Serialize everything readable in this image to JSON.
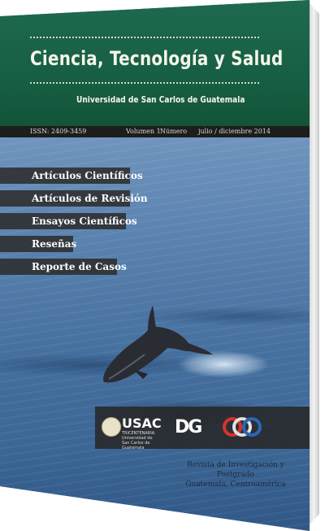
{
  "journal": {
    "title": "Ciencia, Tecnología y Salud",
    "institution": "Universidad de San Carlos de Guatemala"
  },
  "infobar": {
    "issn": "ISSN: 2409-3459",
    "volume": "Volumen 1",
    "number": "Número",
    "period": "julio / diciembre 2014"
  },
  "sections": [
    {
      "label": "Artículos Científicos"
    },
    {
      "label": "Artículos de Revisión"
    },
    {
      "label": "Ensayos Científicos"
    },
    {
      "label": "Reseñas"
    },
    {
      "label": "Reporte de Casos"
    }
  ],
  "logos": {
    "usac": "USAC",
    "usac_sub": "TRICENTENARIA Universidad de San Carlos de Guatemala",
    "dg": "DG",
    "sep": "sep"
  },
  "footer": {
    "line1": "Revista de Investigación y Postgrado",
    "line2": "Guatemala, Centroamérica"
  },
  "colors": {
    "header_green": "#1e6a4e",
    "infobar_dark": "#1d1d1d",
    "sea_blue": "#456f9e",
    "tag_bg": "#2d2d2d"
  }
}
